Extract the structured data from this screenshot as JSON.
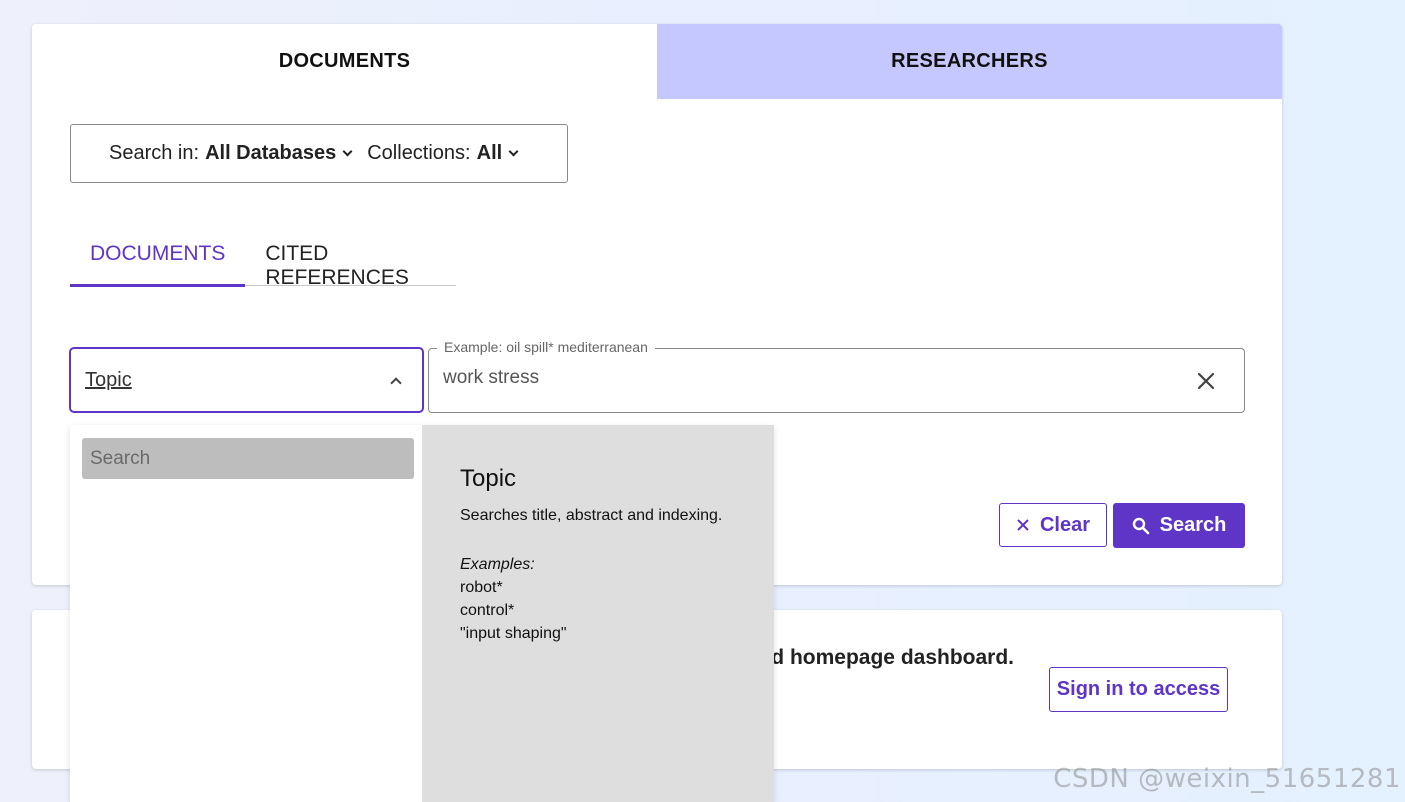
{
  "main_tabs": [
    {
      "label": "DOCUMENTS",
      "active": true
    },
    {
      "label": "RESEARCHERS",
      "active": false
    }
  ],
  "db_bar": {
    "search_in_label": "Search in:",
    "search_in_value": "All Databases",
    "collections_label": "Collections:",
    "collections_value": "All"
  },
  "sub_tabs": [
    {
      "label": "DOCUMENTS",
      "active": true
    },
    {
      "label": "CITED REFERENCES",
      "active": false
    }
  ],
  "field_select": {
    "value": "Topic"
  },
  "query": {
    "legend": "Example: oil spill* mediterranean",
    "value": "work stress"
  },
  "buttons": {
    "clear_label": "Clear",
    "search_label": "Search",
    "signin_label": "Sign in to access"
  },
  "dashboard_text": "d homepage dashboard.",
  "dropdown": {
    "search_placeholder": "Search",
    "title": "Topic",
    "description": "Searches title, abstract and indexing.",
    "examples_label": "Examples:",
    "examples": [
      "robot*",
      "control*",
      "\"input shaping\""
    ]
  },
  "watermark": "CSDN @weixin_51651281",
  "colors": {
    "accent": "#5e35c6",
    "inactive_tab_bg": "#c5c8fe",
    "dropdown_info_bg": "#dedede"
  }
}
